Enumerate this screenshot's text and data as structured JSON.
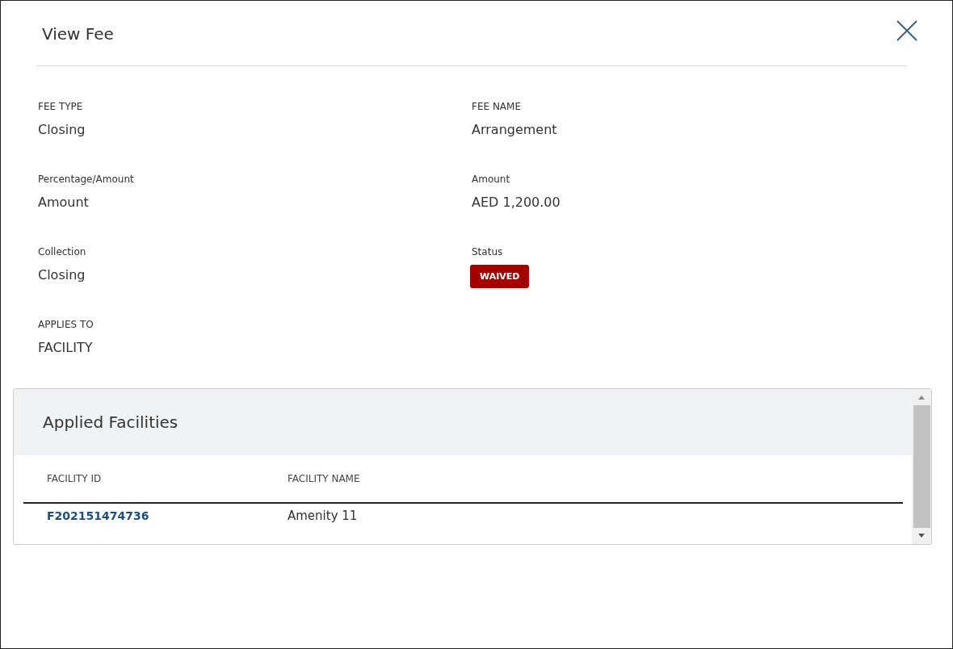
{
  "dialog": {
    "title": "View Fee"
  },
  "fields": [
    {
      "label": "FEE TYPE",
      "value": "Closing",
      "kind": "text"
    },
    {
      "label": "FEE NAME",
      "value": "Arrangement",
      "kind": "text"
    },
    {
      "label": "Percentage/Amount",
      "value": "Amount",
      "kind": "text"
    },
    {
      "label": "Amount",
      "value": "AED 1,200.00",
      "kind": "text"
    },
    {
      "label": "Collection",
      "value": "Closing",
      "kind": "text"
    },
    {
      "label": "Status",
      "value": "WAIVED",
      "kind": "badge"
    },
    {
      "label": "APPLIES TO",
      "value": "FACILITY",
      "kind": "text"
    }
  ],
  "applied_facilities": {
    "title": "Applied Facilities",
    "columns": [
      "FACILITY ID",
      "FACILITY NAME"
    ],
    "rows": [
      {
        "facility_id": "F202151474736",
        "facility_name": "Amenity 11"
      }
    ]
  }
}
